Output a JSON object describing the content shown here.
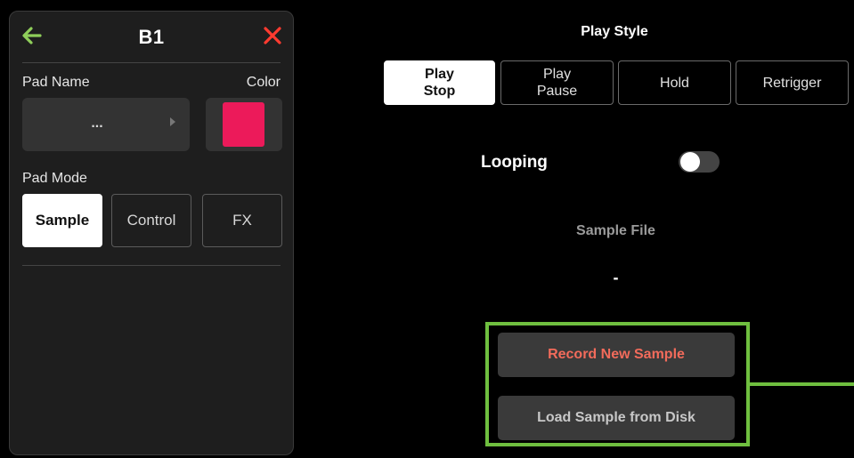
{
  "header": {
    "title": "B1",
    "back_icon": "back-arrow-icon",
    "close_icon": "close-icon",
    "back_color": "#8fce5a",
    "close_color": "#ff3b30"
  },
  "pad_name": {
    "label": "Pad Name",
    "value": "..."
  },
  "color": {
    "label": "Color",
    "value": "#ec1a5a"
  },
  "pad_mode": {
    "label": "Pad Mode",
    "options": [
      "Sample",
      "Control",
      "FX"
    ],
    "selected": "Sample"
  },
  "play_style": {
    "title": "Play Style",
    "options": [
      {
        "label": "Play\nStop",
        "line1": "Play",
        "line2": "Stop"
      },
      {
        "label": "Play\nPause",
        "line1": "Play",
        "line2": "Pause"
      },
      {
        "label": "Hold"
      },
      {
        "label": "Retrigger"
      }
    ],
    "selected": "Play Stop"
  },
  "looping": {
    "label": "Looping",
    "enabled": false
  },
  "sample_file": {
    "label": "Sample File",
    "value": "-"
  },
  "actions": {
    "record_label": "Record New Sample",
    "record_color": "#f26b5b",
    "load_label": "Load Sample from Disk",
    "load_color": "#c8c8c8"
  },
  "highlight_color": "#6fbf3f"
}
